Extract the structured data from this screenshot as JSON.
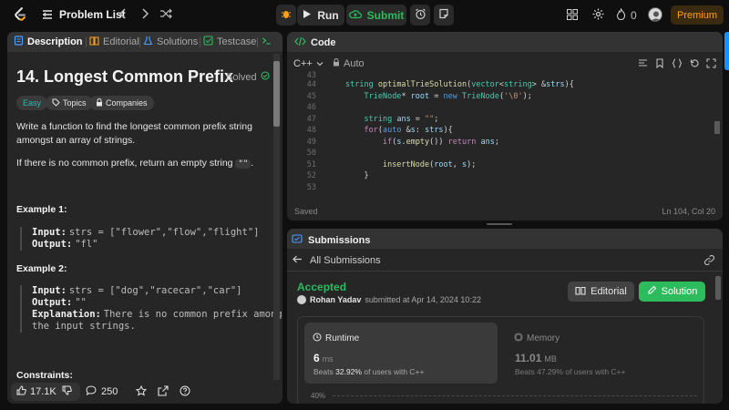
{
  "topbar": {
    "problem_list_label": "Problem List",
    "run_label": "Run",
    "submit_label": "Submit",
    "streak_count": "0",
    "premium_label": "Premium"
  },
  "left": {
    "tabs": [
      {
        "label": "Description"
      },
      {
        "label": "Editorial"
      },
      {
        "label": "Solutions"
      },
      {
        "label": "Testcase"
      }
    ],
    "title": "14. Longest Common Prefix",
    "solved_label": "Solved",
    "chips": {
      "difficulty": "Easy",
      "topics": "Topics",
      "companies": "Companies"
    },
    "desc_1a": "Write a function to find the longest common prefix string",
    "desc_1b": "amongst an array of strings.",
    "desc_2": "If there is no common prefix, return an empty string",
    "desc_2_code": "\"\"",
    "desc_2_end": ".",
    "example1": {
      "head": "Example 1:",
      "input_k": "Input:",
      "input_v": "strs = [\"flower\",\"flow\",\"flight\"]",
      "output_k": "Output:",
      "output_v": "\"fl\""
    },
    "example2": {
      "head": "Example 2:",
      "input_k": "Input:",
      "input_v": "strs = [\"dog\",\"racecar\",\"car\"]",
      "output_k": "Output:",
      "output_v": "\"\"",
      "expl_k": "Explanation:",
      "expl_v1": "There is no common prefix among",
      "expl_v2": "the input strings."
    },
    "constraints_head": "Constraints:",
    "footer": {
      "likes": "17.1K",
      "comments": "250"
    }
  },
  "code": {
    "title": "Code",
    "language": "C++",
    "auto_label": "Auto",
    "line_numbers": [
      "43",
      "44",
      "45",
      "46",
      "47",
      "48",
      "49",
      "50",
      "51",
      "52",
      "53"
    ],
    "saved_label": "Saved",
    "cursor_pos": "Ln 104, Col 20"
  },
  "submissions": {
    "title": "Submissions",
    "back_label": "All Submissions",
    "status": "Accepted",
    "user": "Rohan Yadav",
    "submitted_text": "submitted at Apr 14, 2024 10:22",
    "editorial_label": "Editorial",
    "solution_label": "Solution",
    "runtime": {
      "label": "Runtime",
      "value": "6",
      "unit": "ms",
      "beats_prefix": "Beats",
      "beats_pct": "32.92%",
      "beats_suffix": "of users with C++"
    },
    "memory": {
      "label": "Memory",
      "value": "11.01",
      "unit": "MB",
      "beats_prefix": "Beats",
      "beats_pct": "47.29%",
      "beats_suffix": "of users with C++"
    },
    "pct_axis_label": "40%"
  },
  "colors": {
    "accent_green": "#2cbb5d",
    "premium_orange": "#ffa116",
    "easy_teal": "#2cbbb4",
    "panel_bg": "#262626"
  }
}
